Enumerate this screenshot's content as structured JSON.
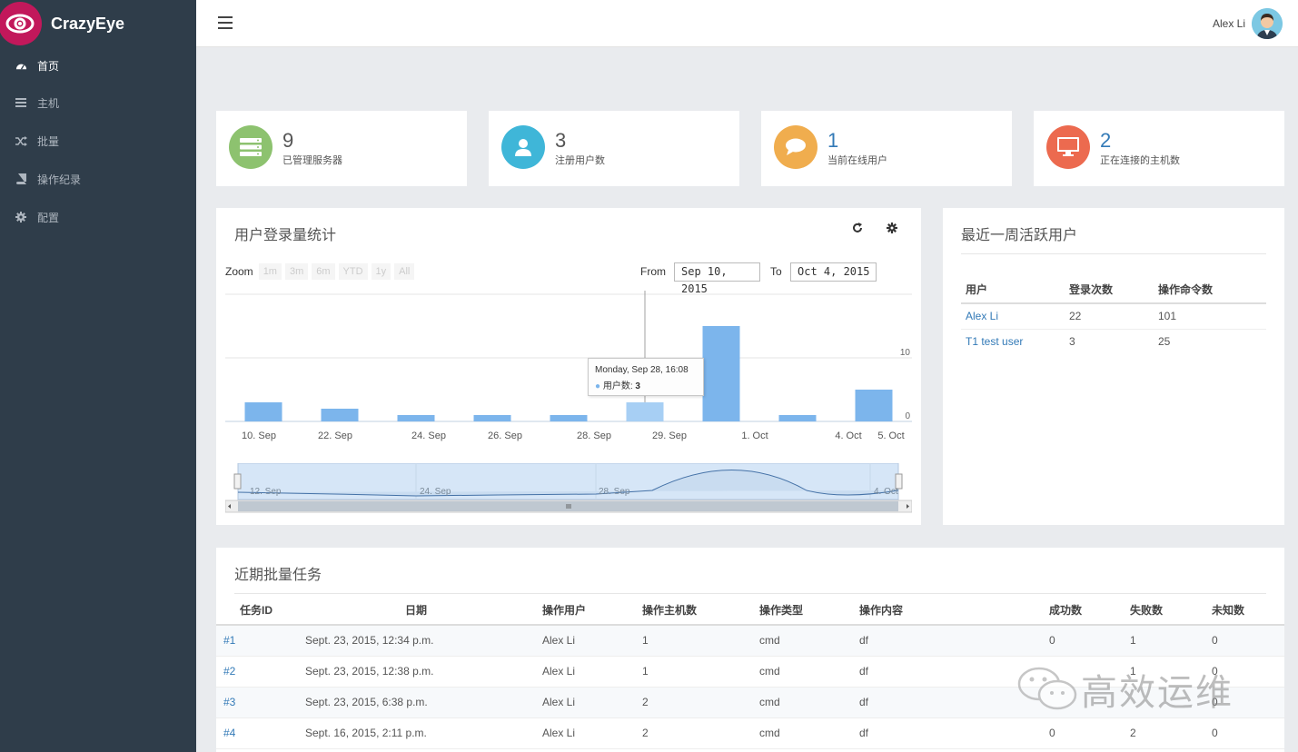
{
  "app": {
    "name": "CrazyEye"
  },
  "sidebar": {
    "items": [
      {
        "label": "首页",
        "icon": "dashboard-icon"
      },
      {
        "label": "主机",
        "icon": "server-list-icon"
      },
      {
        "label": "批量",
        "icon": "shuffle-icon"
      },
      {
        "label": "操作纪录",
        "icon": "book-icon"
      },
      {
        "label": "配置",
        "icon": "gear-icon"
      }
    ]
  },
  "header": {
    "user_name": "Alex Li"
  },
  "stats": [
    {
      "value": "9",
      "label": "已管理服务器",
      "color": "#8dc26f",
      "icon": "server-icon"
    },
    {
      "value": "3",
      "label": "注册用户数",
      "color": "#3fb6d8",
      "icon": "user-icon"
    },
    {
      "value": "1",
      "label": "当前在线用户",
      "color": "#f0ad4e",
      "icon": "chat-icon"
    },
    {
      "value": "2",
      "label": "正在连接的主机数",
      "color": "#ec6a4f",
      "icon": "monitor-icon"
    }
  ],
  "login_chart": {
    "title": "用户登录量统计",
    "zoom_label": "Zoom",
    "zoom_options": [
      "1m",
      "3m",
      "6m",
      "YTD",
      "1y",
      "All"
    ],
    "from_label": "From",
    "from_value": "Sep 10, 2015",
    "to_label": "To",
    "to_value": "Oct 4, 2015",
    "tooltip_date": "Monday, Sep 28, 16:08",
    "tooltip_series": "用户数:",
    "tooltip_value": "3",
    "navigator_labels": [
      "12. Sep",
      "24. Sep",
      "28. Sep",
      "4. Oct"
    ]
  },
  "chart_data": {
    "type": "bar",
    "categories": [
      "10. Sep",
      "22. Sep",
      "24. Sep",
      "26. Sep",
      "28. Sep",
      "29. Sep",
      "1. Oct",
      "4. Oct",
      "5. Oct"
    ],
    "values": [
      3,
      2,
      1,
      1,
      1,
      3,
      15,
      1,
      5
    ],
    "ylim": [
      0,
      20
    ],
    "yticks": [
      0,
      10
    ],
    "highlight_index": 5
  },
  "active_users": {
    "title": "最近一周活跃用户",
    "columns": [
      "用户",
      "登录次数",
      "操作命令数"
    ],
    "rows": [
      {
        "user": "Alex Li",
        "logins": "22",
        "commands": "101"
      },
      {
        "user": "T1 test user",
        "logins": "3",
        "commands": "25"
      }
    ]
  },
  "tasks": {
    "title": "近期批量任务",
    "columns": [
      "任务ID",
      "日期",
      "操作用户",
      "操作主机数",
      "操作类型",
      "操作内容",
      "成功数",
      "失败数",
      "未知数"
    ],
    "rows": [
      {
        "id": "#1",
        "date": "Sept. 23, 2015, 12:34 p.m.",
        "user": "Alex Li",
        "hosts": "1",
        "type": "cmd",
        "content": "df",
        "success": "0",
        "fail": "1",
        "unknown": "0"
      },
      {
        "id": "#2",
        "date": "Sept. 23, 2015, 12:38 p.m.",
        "user": "Alex Li",
        "hosts": "1",
        "type": "cmd",
        "content": "df",
        "success": "",
        "fail": "1",
        "unknown": "0"
      },
      {
        "id": "#3",
        "date": "Sept. 23, 2015, 6:38 p.m.",
        "user": "Alex Li",
        "hosts": "2",
        "type": "cmd",
        "content": "df",
        "success": "",
        "fail": "",
        "unknown": "0"
      },
      {
        "id": "#4",
        "date": "Sept. 16, 2015, 2:11 p.m.",
        "user": "Alex Li",
        "hosts": "2",
        "type": "cmd",
        "content": "df",
        "success": "0",
        "fail": "2",
        "unknown": "0"
      }
    ]
  },
  "watermark": "高效运维"
}
